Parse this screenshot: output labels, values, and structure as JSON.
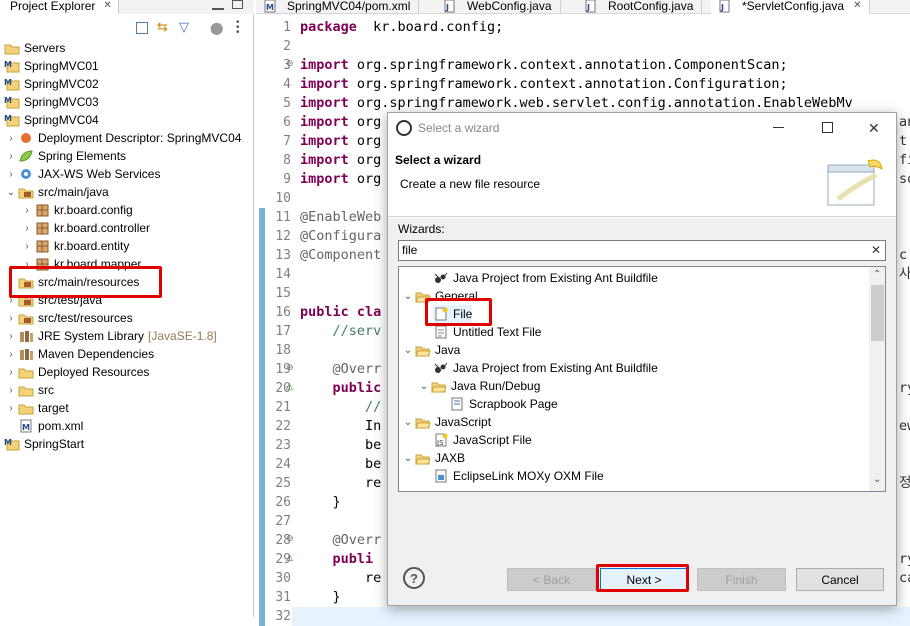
{
  "project_explorer": {
    "tab_label": "Project Explorer",
    "tab_close": "✕",
    "items": [
      {
        "label": "Servers",
        "icon": "folder-icon",
        "level": 0,
        "chevron": ""
      },
      {
        "label": "SpringMVC01",
        "icon": "maven-project-icon",
        "level": 0,
        "chevron": ""
      },
      {
        "label": "SpringMVC02",
        "icon": "maven-project-icon",
        "level": 0,
        "chevron": ""
      },
      {
        "label": "SpringMVC03",
        "icon": "maven-project-icon",
        "level": 0,
        "chevron": ""
      },
      {
        "label": "SpringMVC04",
        "icon": "maven-project-icon",
        "level": 0,
        "chevron": ""
      },
      {
        "label": "Deployment Descriptor: SpringMVC04",
        "icon": "deployment-descriptor-icon",
        "level": 1,
        "chevron": "›"
      },
      {
        "label": "Spring Elements",
        "icon": "spring-leaf-icon",
        "level": 1,
        "chevron": "›"
      },
      {
        "label": "JAX-WS Web Services",
        "icon": "web-services-icon",
        "level": 1,
        "chevron": "›"
      },
      {
        "label": "src/main/java",
        "icon": "source-folder-icon",
        "level": 1,
        "chevron": "⌄"
      },
      {
        "label": "kr.board.config",
        "icon": "package-icon",
        "level": 2,
        "chevron": "›"
      },
      {
        "label": "kr.board.controller",
        "icon": "package-icon",
        "level": 2,
        "chevron": "›"
      },
      {
        "label": "kr.board.entity",
        "icon": "package-icon",
        "level": 2,
        "chevron": "›"
      },
      {
        "label": "kr.board.mapper",
        "icon": "package-icon",
        "level": 2,
        "chevron": "›"
      },
      {
        "label": "src/main/resources",
        "icon": "source-folder-icon",
        "level": 1,
        "chevron": "›"
      },
      {
        "label": "src/test/java",
        "icon": "source-folder-icon",
        "level": 1,
        "chevron": "›"
      },
      {
        "label": "src/test/resources",
        "icon": "source-folder-icon",
        "level": 1,
        "chevron": "›"
      },
      {
        "label": "JRE System Library",
        "suffix": "[JavaSE-1.8]",
        "icon": "library-icon",
        "level": 1,
        "chevron": "›"
      },
      {
        "label": "Maven Dependencies",
        "icon": "library-icon",
        "level": 1,
        "chevron": "›"
      },
      {
        "label": "Deployed Resources",
        "icon": "folder-icon",
        "level": 1,
        "chevron": "›"
      },
      {
        "label": "src",
        "icon": "folder-icon",
        "level": 1,
        "chevron": "›"
      },
      {
        "label": "target",
        "icon": "folder-icon",
        "level": 1,
        "chevron": "›"
      },
      {
        "label": "pom.xml",
        "icon": "xml-file-icon",
        "level": 1,
        "chevron": ""
      },
      {
        "label": "SpringStart",
        "icon": "project-icon",
        "level": 0,
        "chevron": ""
      }
    ]
  },
  "editor": {
    "tabs": [
      {
        "label": "SpringMVC04/pom.xml",
        "icon": "xml-file-icon",
        "active": false,
        "close": ""
      },
      {
        "label": "WebConfig.java",
        "icon": "java-file-icon",
        "active": false,
        "close": ""
      },
      {
        "label": "RootConfig.java",
        "icon": "java-file-icon",
        "active": false,
        "close": ""
      },
      {
        "label": "*ServletConfig.java",
        "icon": "java-file-icon",
        "active": true,
        "close": "✕"
      }
    ],
    "lines": [
      {
        "no": "1",
        "marker": "",
        "parts": [
          [
            "kw",
            "package"
          ],
          [
            "",
            "  kr.board.config;"
          ]
        ]
      },
      {
        "no": "2",
        "marker": "",
        "parts": []
      },
      {
        "no": "3",
        "marker": "⊖",
        "parts": [
          [
            "kw",
            "import"
          ],
          [
            "",
            " org.springframework.context.annotation.ComponentScan;"
          ]
        ]
      },
      {
        "no": "4",
        "marker": "",
        "parts": [
          [
            "kw",
            "import"
          ],
          [
            "",
            " org.springframework.context.annotation.Configuration;"
          ]
        ]
      },
      {
        "no": "5",
        "marker": "",
        "parts": [
          [
            "kw",
            "import"
          ],
          [
            "",
            " org.springframework.web.servlet.config.annotation.EnableWebMv"
          ]
        ]
      },
      {
        "no": "6",
        "marker": "",
        "parts": [
          [
            "kw",
            "import"
          ],
          [
            "",
            " org"
          ]
        ]
      },
      {
        "no": "7",
        "marker": "",
        "parts": [
          [
            "kw",
            "import"
          ],
          [
            "",
            " org"
          ]
        ]
      },
      {
        "no": "8",
        "marker": "",
        "parts": [
          [
            "kw",
            "import"
          ],
          [
            "",
            " org"
          ]
        ]
      },
      {
        "no": "9",
        "marker": "",
        "parts": [
          [
            "kw",
            "import"
          ],
          [
            "",
            " org"
          ]
        ]
      },
      {
        "no": "10",
        "marker": "",
        "parts": []
      },
      {
        "no": "11",
        "marker": "",
        "parts": [
          [
            "ann",
            "@EnableWeb"
          ]
        ]
      },
      {
        "no": "12",
        "marker": "",
        "parts": [
          [
            "ann",
            "@Configura"
          ]
        ]
      },
      {
        "no": "13",
        "marker": "",
        "parts": [
          [
            "ann",
            "@Component"
          ]
        ]
      },
      {
        "no": "14",
        "marker": "",
        "parts": []
      },
      {
        "no": "15",
        "marker": "",
        "parts": []
      },
      {
        "no": "16",
        "marker": "",
        "parts": [
          [
            "kw",
            "public"
          ],
          [
            "",
            " "
          ],
          [
            "kw",
            "cla"
          ]
        ]
      },
      {
        "no": "17",
        "marker": "",
        "parts": [
          [
            "",
            "    "
          ],
          [
            "cmt",
            "//serv"
          ]
        ]
      },
      {
        "no": "18",
        "marker": "",
        "parts": []
      },
      {
        "no": "19",
        "marker": "⊖",
        "parts": [
          [
            "",
            "    "
          ],
          [
            "ann",
            "@Overr"
          ]
        ]
      },
      {
        "no": "20",
        "marker": "△",
        "parts": [
          [
            "",
            "    "
          ],
          [
            "kw",
            "public"
          ]
        ]
      },
      {
        "no": "21",
        "marker": "",
        "parts": [
          [
            "",
            "        "
          ],
          [
            "cmt",
            "//"
          ]
        ]
      },
      {
        "no": "22",
        "marker": "",
        "parts": [
          [
            "",
            "        In"
          ]
        ]
      },
      {
        "no": "23",
        "marker": "",
        "parts": [
          [
            "",
            "        be"
          ]
        ]
      },
      {
        "no": "24",
        "marker": "",
        "parts": [
          [
            "",
            "        be"
          ]
        ]
      },
      {
        "no": "25",
        "marker": "",
        "parts": [
          [
            "",
            "        re"
          ]
        ]
      },
      {
        "no": "26",
        "marker": "",
        "parts": [
          [
            "",
            "    }"
          ]
        ]
      },
      {
        "no": "27",
        "marker": "",
        "parts": []
      },
      {
        "no": "28",
        "marker": "⊖",
        "parts": [
          [
            "",
            "    "
          ],
          [
            "ann",
            "@Overr"
          ]
        ]
      },
      {
        "no": "29",
        "marker": "△",
        "parts": [
          [
            "",
            "    "
          ],
          [
            "kw",
            "publi"
          ]
        ]
      },
      {
        "no": "30",
        "marker": "",
        "parts": [
          [
            "",
            "        re"
          ]
        ]
      },
      {
        "no": "31",
        "marker": "",
        "parts": [
          [
            "",
            "    }"
          ]
        ]
      },
      {
        "no": "32",
        "marker": "",
        "parts": []
      }
    ],
    "right_fragments": [
      {
        "text": "an",
        "line": 6
      },
      {
        "text": "t",
        "line": 7
      },
      {
        "text": "fi",
        "line": 8
      },
      {
        "text": "so",
        "line": 9
      },
      {
        "text": "c",
        "line": 13
      },
      {
        "text": "사",
        "line": 14
      },
      {
        "text": "ry",
        "line": 20
      },
      {
        "text": "ew",
        "line": 22
      },
      {
        "text": "정처",
        "line": 25
      },
      {
        "text": "ry",
        "line": 29
      },
      {
        "text": "ca",
        "line": 30
      }
    ]
  },
  "wizard": {
    "title": "Select a wizard",
    "header_title": "Select a wizard",
    "header_subtitle": "Create a new file resource",
    "wizards_label": "Wizards:",
    "filter_value": "file",
    "filter_clear": "✕",
    "tree": [
      {
        "label": "Java Project from Existing Ant Buildfile",
        "icon": "ant-icon",
        "level": 1,
        "chevron": ""
      },
      {
        "label": "General",
        "icon": "folder-open-icon",
        "level": 0,
        "chevron": "⌄"
      },
      {
        "label": "File",
        "icon": "new-file-icon",
        "level": 1,
        "chevron": ""
      },
      {
        "label": "Untitled Text File",
        "icon": "text-file-icon",
        "level": 1,
        "chevron": ""
      },
      {
        "label": "Java",
        "icon": "folder-open-icon",
        "level": 0,
        "chevron": "⌄"
      },
      {
        "label": "Java Project from Existing Ant Buildfile",
        "icon": "ant-icon",
        "level": 1,
        "chevron": ""
      },
      {
        "label": "Java Run/Debug",
        "icon": "folder-open-icon",
        "level": 1,
        "chevron": "⌄"
      },
      {
        "label": "Scrapbook Page",
        "icon": "scrapbook-icon",
        "level": 2,
        "chevron": ""
      },
      {
        "label": "JavaScript",
        "icon": "folder-open-icon",
        "level": 0,
        "chevron": "⌄"
      },
      {
        "label": "JavaScript File",
        "icon": "javascript-file-icon",
        "level": 1,
        "chevron": ""
      },
      {
        "label": "JAXB",
        "icon": "folder-open-icon",
        "level": 0,
        "chevron": "⌄"
      },
      {
        "label": "EclipseLink MOXy OXM File",
        "icon": "oxm-file-icon",
        "level": 1,
        "chevron": ""
      }
    ],
    "buttons": {
      "help": "?",
      "back": "< Back",
      "next": "Next >",
      "finish": "Finish",
      "cancel": "Cancel"
    },
    "window_controls": {
      "minimize": "",
      "maximize": "",
      "close": "✕"
    }
  },
  "colors": {
    "highlight_box": "#e00000",
    "keyword": "#7f0055",
    "annotation": "#646464",
    "comment": "#3f7f5f",
    "change_bar": "#7ab3d6"
  }
}
